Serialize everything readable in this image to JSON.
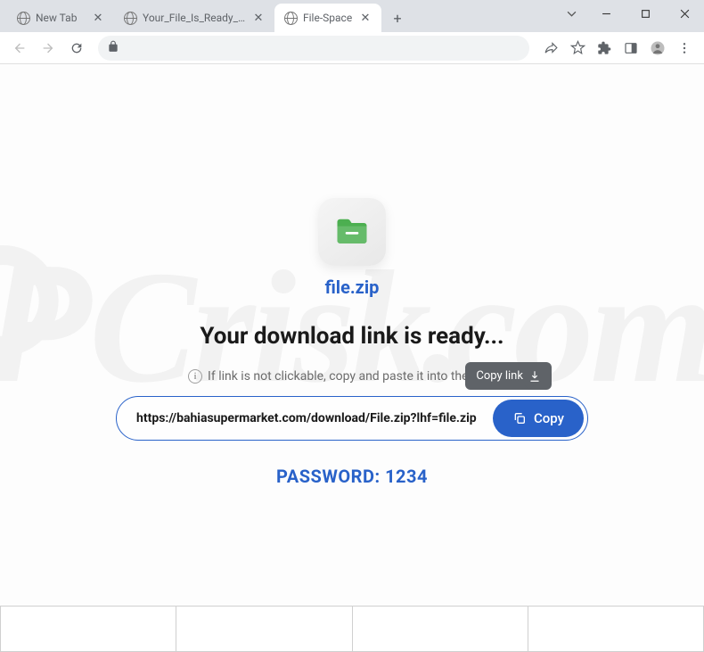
{
  "window": {
    "tabs": [
      {
        "title": "New Tab"
      },
      {
        "title": "Your_File_Is_Ready_To_Downl"
      },
      {
        "title": "File-Space"
      }
    ],
    "active_tab_index": 2
  },
  "page": {
    "filename": "file.zip",
    "heading": "Your download link is ready...",
    "hint_text": "If link is not clickable, copy and paste it into the address",
    "tooltip_text": "Copy link",
    "download_url": "https://bahiasupermarket.com/download/File.zip?lhf=file.zip",
    "copy_button_label": "Copy",
    "password_label": "PASSWORD: 1234"
  },
  "watermark": "PCrisk.com",
  "colors": {
    "accent": "#2962c9"
  }
}
